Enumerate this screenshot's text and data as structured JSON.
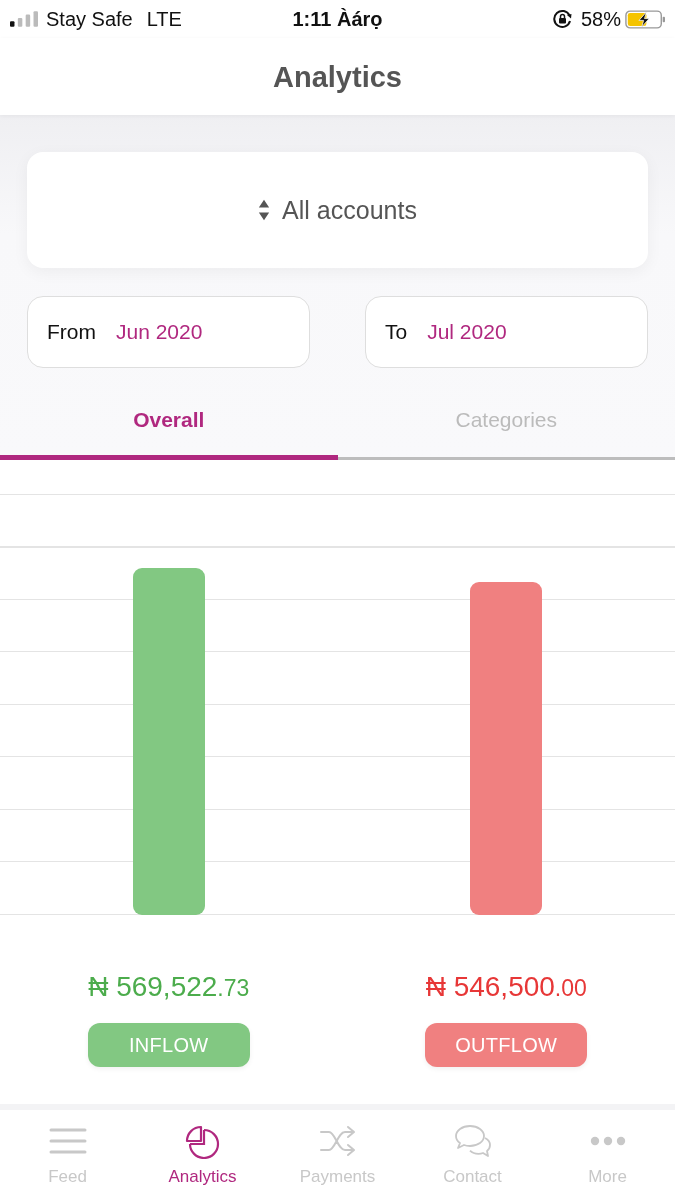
{
  "status_bar": {
    "carrier": "Stay Safe",
    "network": "LTE",
    "time": "1:11 Àárọ",
    "battery": "58%"
  },
  "header": {
    "title": "Analytics"
  },
  "account_selector": {
    "value": "All accounts"
  },
  "date_range": [
    {
      "label": "From",
      "value": "Jun 2020"
    },
    {
      "label": "To",
      "value": "Jul 2020"
    }
  ],
  "tabs": [
    {
      "label": "Overall",
      "selected": true
    },
    {
      "label": "Categories",
      "selected": false
    }
  ],
  "flows": [
    {
      "amount": "₦ 569,522",
      "decimals": ".73",
      "label": "INFLOW",
      "color": "#82c882"
    },
    {
      "amount": "₦ 546,500",
      "decimals": ".00",
      "label": "OUTFLOW",
      "color": "#f08080"
    }
  ],
  "bottom_nav": [
    {
      "label": "Feed",
      "selected": false
    },
    {
      "label": "Analytics",
      "selected": true
    },
    {
      "label": "Payments",
      "selected": false
    },
    {
      "label": "Contact",
      "selected": false
    },
    {
      "label": "More",
      "selected": false
    }
  ]
}
